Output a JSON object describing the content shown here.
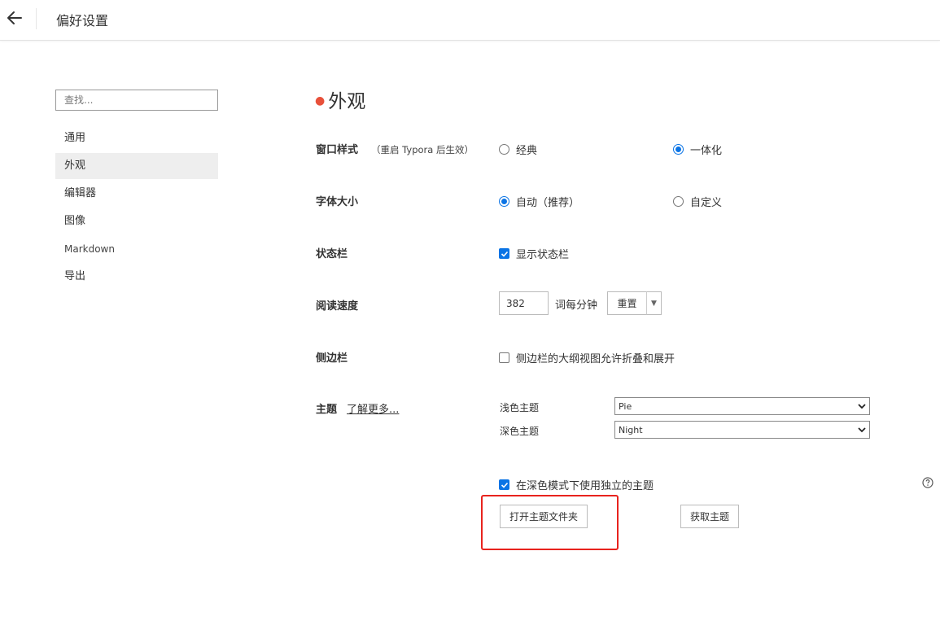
{
  "header": {
    "title": "偏好设置",
    "back_icon": "arrow-left-icon"
  },
  "sidebar": {
    "search_placeholder": "查找...",
    "items": [
      {
        "label": "通用"
      },
      {
        "label": "外观",
        "active": true
      },
      {
        "label": "编辑器"
      },
      {
        "label": "图像"
      },
      {
        "label": "Markdown"
      },
      {
        "label": "导出"
      }
    ]
  },
  "main": {
    "section_title": "外观",
    "window_style": {
      "label": "窗口样式",
      "hint": "（重启 Typora 后生效）",
      "options": [
        {
          "label": "经典",
          "selected": false
        },
        {
          "label": "一体化",
          "selected": true
        }
      ]
    },
    "font_size": {
      "label": "字体大小",
      "options": [
        {
          "label": "自动（推荐）",
          "selected": true
        },
        {
          "label": "自定义",
          "selected": false
        }
      ]
    },
    "status_bar": {
      "label": "状态栏",
      "checkbox_label": "显示状态栏",
      "checked": true
    },
    "reading_speed": {
      "label": "阅读速度",
      "value": "382",
      "unit": "词每分钟",
      "reset_label": "重置"
    },
    "sidebar_setting": {
      "label": "侧边栏",
      "checkbox_label": "侧边栏的大纲视图允许折叠和展开",
      "checked": false
    },
    "theme": {
      "label": "主题",
      "learn_more": "了解更多...",
      "light_label": "浅色主题",
      "light_value": "Pie",
      "dark_label": "深色主题",
      "dark_value": "Night",
      "separate_dark_label": "在深色模式下使用独立的主题",
      "separate_dark_checked": true,
      "open_folder_label": "打开主题文件夹",
      "get_themes_label": "获取主题"
    }
  },
  "colors": {
    "accent": "#0b74e5",
    "dot": "#e8503a",
    "highlight": "#e8231e"
  }
}
